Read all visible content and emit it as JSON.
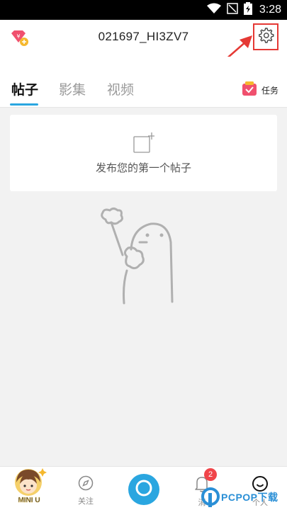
{
  "status_bar": {
    "time": "3:28",
    "icons": [
      "wifi-icon",
      "signal-icon",
      "battery-icon"
    ]
  },
  "header": {
    "title": "021697_HI3ZV7",
    "left_icon": "vip-diamond-icon",
    "right_icon": "gear-icon"
  },
  "tabs": [
    {
      "label": "帖子",
      "active": true
    },
    {
      "label": "影集",
      "active": false
    },
    {
      "label": "视频",
      "active": false
    }
  ],
  "task": {
    "label": "任务",
    "icon": "task-bag-icon"
  },
  "post_card": {
    "text": "发布您的第一个帖子",
    "icon": "add-post-icon"
  },
  "bottom_nav": {
    "items": [
      {
        "label": "MINI U",
        "icon": "mini-u-avatar-icon"
      },
      {
        "label": "关注",
        "icon": "compass-icon"
      },
      {
        "label": "",
        "icon": "camera-icon"
      },
      {
        "label": "消",
        "icon": "bell-icon",
        "badge": "2"
      },
      {
        "label": "个人",
        "icon": "smile-icon"
      }
    ]
  },
  "watermark": {
    "text": "PCPOP下载"
  },
  "colors": {
    "accent": "#2aa6e0",
    "annotation": "#e53935",
    "badge": "#f0454a",
    "task": "#f0506e"
  }
}
